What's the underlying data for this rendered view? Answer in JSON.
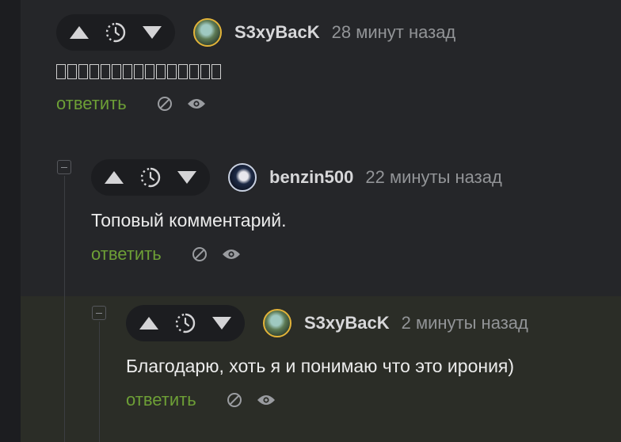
{
  "comments": [
    {
      "username": "S3xyBacK",
      "time": "28 минут назад",
      "text": "□□□□□□□□□□□□□□□",
      "reply_label": "ответить"
    },
    {
      "username": "benzin500",
      "time": "22 минуты назад",
      "text": "Топовый комментарий.",
      "reply_label": "ответить"
    },
    {
      "username": "S3xyBacK",
      "time": "2 минуты назад",
      "text": "Благодарю, хоть я и понимаю что это ирония)",
      "reply_label": "ответить"
    }
  ],
  "icons": {
    "upvote": "triangle-up-icon",
    "vote_timer": "clock-timer-icon",
    "downvote": "triangle-down-icon",
    "hide": "block-icon",
    "watch": "eye-icon"
  },
  "colors": {
    "background": "#252629",
    "highlight": "#2b2d27",
    "reply": "#6d9f36",
    "username": "#d7d7d9",
    "time": "#929497"
  }
}
